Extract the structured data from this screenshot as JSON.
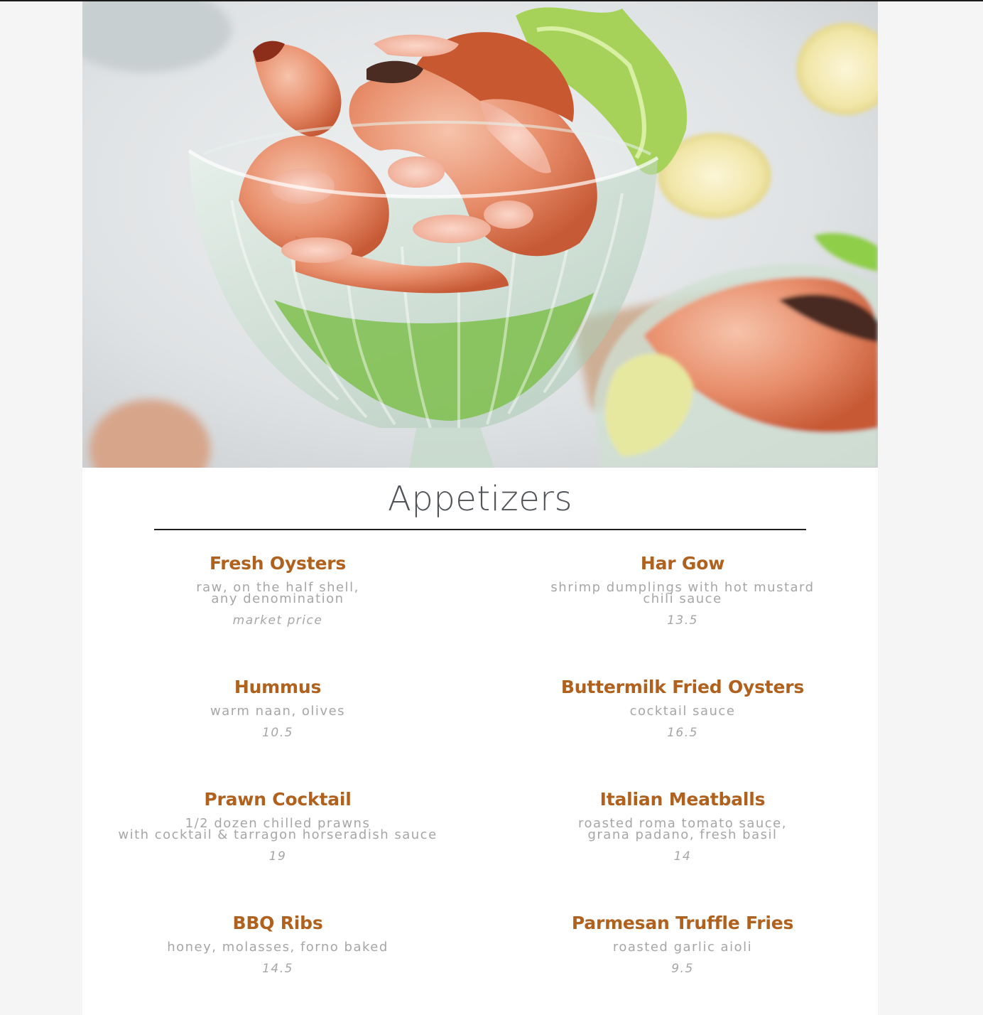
{
  "hero": {
    "image_alt": "Shrimp cocktail served in glass coupes with lettuce, lemon and sauce"
  },
  "section": {
    "title": "Appetizers"
  },
  "colors": {
    "title": "#505459",
    "item_name": "#b0611d",
    "item_text": "#a6a6a6",
    "rule": "#1f1f1f"
  },
  "items": [
    {
      "name": "Fresh Oysters",
      "desc": [
        "raw, on the half shell,",
        "any denomination"
      ],
      "price": "market price"
    },
    {
      "name": "Har Gow",
      "desc": [
        "shrimp dumplings with hot mustard",
        "chili sauce"
      ],
      "price": "13.5"
    },
    {
      "name": "Hummus",
      "desc": [
        "warm naan, olives"
      ],
      "price": "10.5"
    },
    {
      "name": "Buttermilk Fried Oysters",
      "desc": [
        "cocktail sauce"
      ],
      "price": "16.5"
    },
    {
      "name": "Prawn Cocktail",
      "desc": [
        "1/2 dozen chilled prawns",
        "with cocktail & tarragon horseradish sauce"
      ],
      "price": "19"
    },
    {
      "name": "Italian Meatballs",
      "desc": [
        "roasted roma tomato sauce,",
        "grana padano, fresh basil"
      ],
      "price": "14"
    },
    {
      "name": "BBQ Ribs",
      "desc": [
        "honey, molasses, forno baked"
      ],
      "price": "14.5"
    },
    {
      "name": "Parmesan Truffle Fries",
      "desc": [
        "roasted garlic aioli"
      ],
      "price": "9.5"
    }
  ]
}
